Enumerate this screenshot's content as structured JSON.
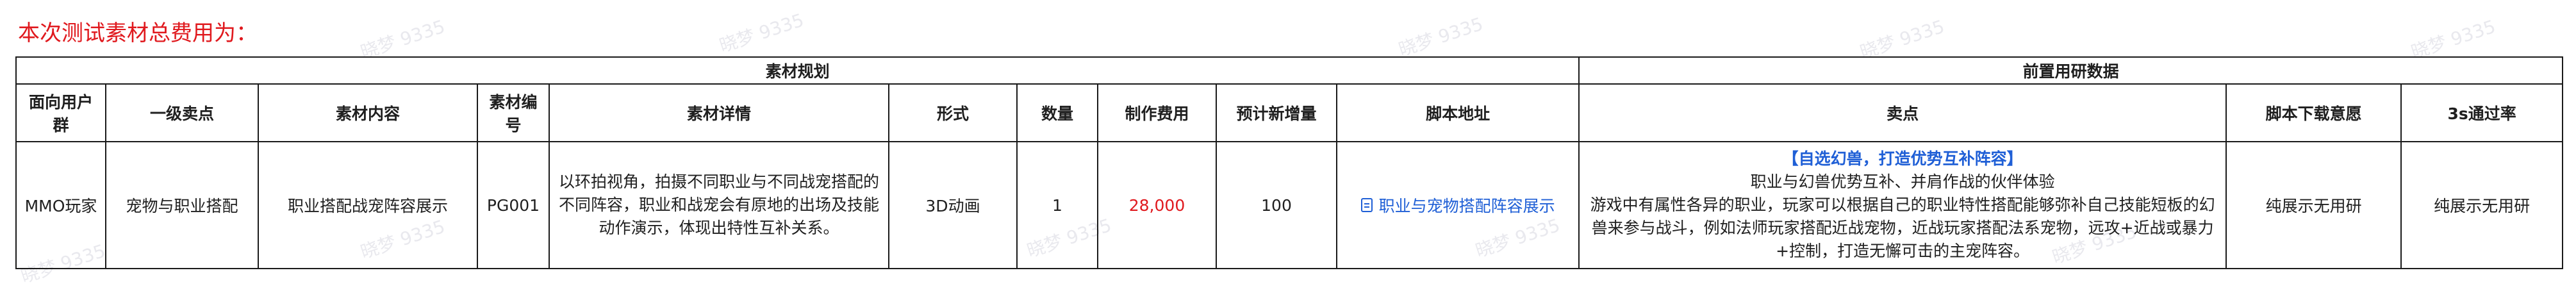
{
  "title": "本次测试素材总费用为：",
  "watermark": "晓梦 9335",
  "groups": {
    "left": "素材规划",
    "right": "前置用研数据"
  },
  "headers": [
    "面向用户群",
    "一级卖点",
    "素材内容",
    "素材编号",
    "素材详情",
    "形式",
    "数量",
    "制作费用",
    "预计新增量",
    "脚本地址",
    "卖点",
    "脚本下载意愿",
    "3s通过率"
  ],
  "row": {
    "audience": "MMO玩家",
    "primary_point": "宠物与职业搭配",
    "content": "职业搭配战宠阵容展示",
    "code": "PG001",
    "detail": "以环拍视角，拍摄不同职业与不同战宠搭配的不同阵容，职业和战宠会有原地的出场及技能动作演示，体现出特性互补关系。",
    "format": "3D动画",
    "quantity": "1",
    "cost": "28,000",
    "expected_new": "100",
    "script_link": "职业与宠物搭配阵容展示",
    "selling_head": "【自选幻兽，打造优势互补阵容】",
    "selling_sub": "职业与幻兽优势互补、并肩作战的伙伴体验",
    "selling_body": "游戏中有属性各异的职业，玩家可以根据自己的职业特性搭配能够弥补自己技能短板的幻兽来参与战斗，例如法师玩家搭配近战宠物，近战玩家搭配法系宠物，远攻+近战或暴力+控制，打造无懈可击的主宠阵容。",
    "download_intent": "纯展示无用研",
    "pass_rate": "纯展示无用研"
  },
  "colors": {
    "red": "#e0191e",
    "link": "#1f5fd6"
  }
}
